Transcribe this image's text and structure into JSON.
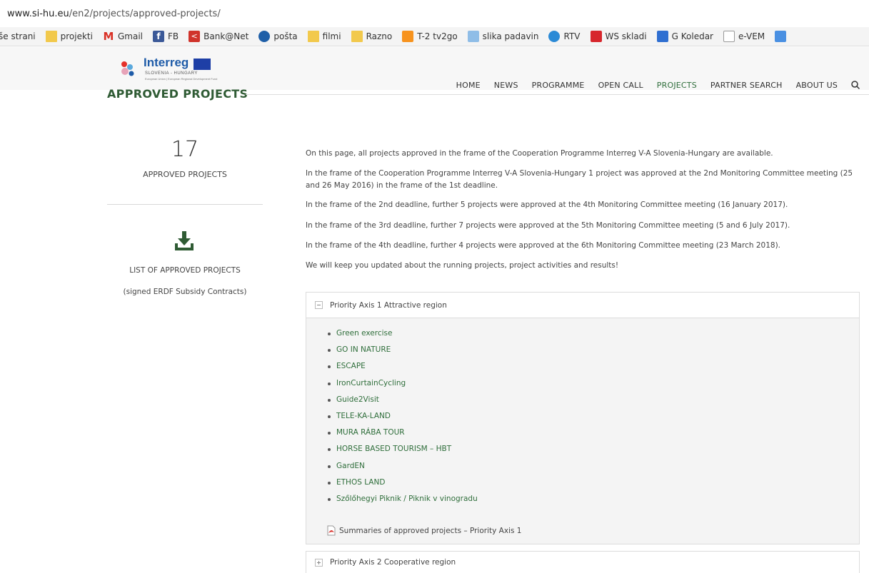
{
  "browser": {
    "url_host": "www.si-hu.eu",
    "url_path": "/en2/projects/approved-projects/",
    "bookmarks": [
      {
        "label": "še strani",
        "icon": "none"
      },
      {
        "label": "projekti",
        "icon": "folder"
      },
      {
        "label": "Gmail",
        "icon": "gmail"
      },
      {
        "label": "FB",
        "icon": "facebook"
      },
      {
        "label": "Bank@Net",
        "icon": "bank"
      },
      {
        "label": "pošta",
        "icon": "posta"
      },
      {
        "label": "filmi",
        "icon": "folder"
      },
      {
        "label": "Razno",
        "icon": "folder"
      },
      {
        "label": "T-2 tv2go",
        "icon": "tv"
      },
      {
        "label": "slika padavin",
        "icon": "rain"
      },
      {
        "label": "RTV",
        "icon": "rtv"
      },
      {
        "label": "WS skladi",
        "icon": "ws"
      },
      {
        "label": "G Koledar",
        "icon": "calendar"
      },
      {
        "label": "e-VEM",
        "icon": "document"
      }
    ]
  },
  "site": {
    "logo_word": "Interreg",
    "logo_sub": "SLOVENIA - HUNGARY",
    "logo_sub2": "European Union | European Regional Development Fund",
    "nav": [
      {
        "label": "HOME",
        "active": false
      },
      {
        "label": "NEWS",
        "active": false
      },
      {
        "label": "PROGRAMME",
        "active": false
      },
      {
        "label": "OPEN CALL",
        "active": false
      },
      {
        "label": "PROJECTS",
        "active": true
      },
      {
        "label": "PARTNER SEARCH",
        "active": false
      },
      {
        "label": "ABOUT US",
        "active": false
      }
    ],
    "accent_color": "#2f6e3b"
  },
  "page": {
    "title": "APPROVED PROJECTS",
    "count": "17",
    "count_label": "APPROVED PROJECTS",
    "download_label": "LIST OF APPROVED PROJECTS",
    "download_sub": "(signed ERDF Subsidy Contracts)",
    "intro": [
      "On this page, all projects approved in the frame of the Cooperation Programme Interreg V-A Slovenia-Hungary are available.",
      "In the frame of the Cooperation Programme Interreg V-A Slovenia-Hungary 1 project was approved at the 2nd Monitoring Committee meeting (25 and 26 May 2016) in the frame of the 1st deadline.",
      "In the frame of the 2nd deadline, further 5 projects were approved at the 4th Monitoring Committee meeting (16 January 2017).",
      "In the frame of the 3rd deadline, further 7 projects were approved at the 5th Monitoring Committee meeting (5 and 6 July 2017).",
      "In the frame of the 4th deadline, further 4 projects were approved at the 6th Monitoring Committee meeting (23 March 2018).",
      "We will keep you updated about the running projects, project activities and results!"
    ],
    "axis1": {
      "title": "Priority Axis 1 Attractive region",
      "expanded": true,
      "projects": [
        "Green exercise",
        "GO IN NATURE",
        "ESCAPE",
        "IronCurtainCycling",
        "Guide2Visit",
        "TELE-KA-LAND",
        "MURA RÁBA TOUR",
        "HORSE BASED TOURISM – HBT",
        "GardEN",
        "ETHOS LAND",
        "Szőlőhegyi Piknik / Piknik v vinogradu"
      ],
      "summary_link": "Summaries of approved projects – Priority Axis 1"
    },
    "axis2": {
      "title": "Priority Axis 2 Cooperative region",
      "expanded": false
    }
  }
}
